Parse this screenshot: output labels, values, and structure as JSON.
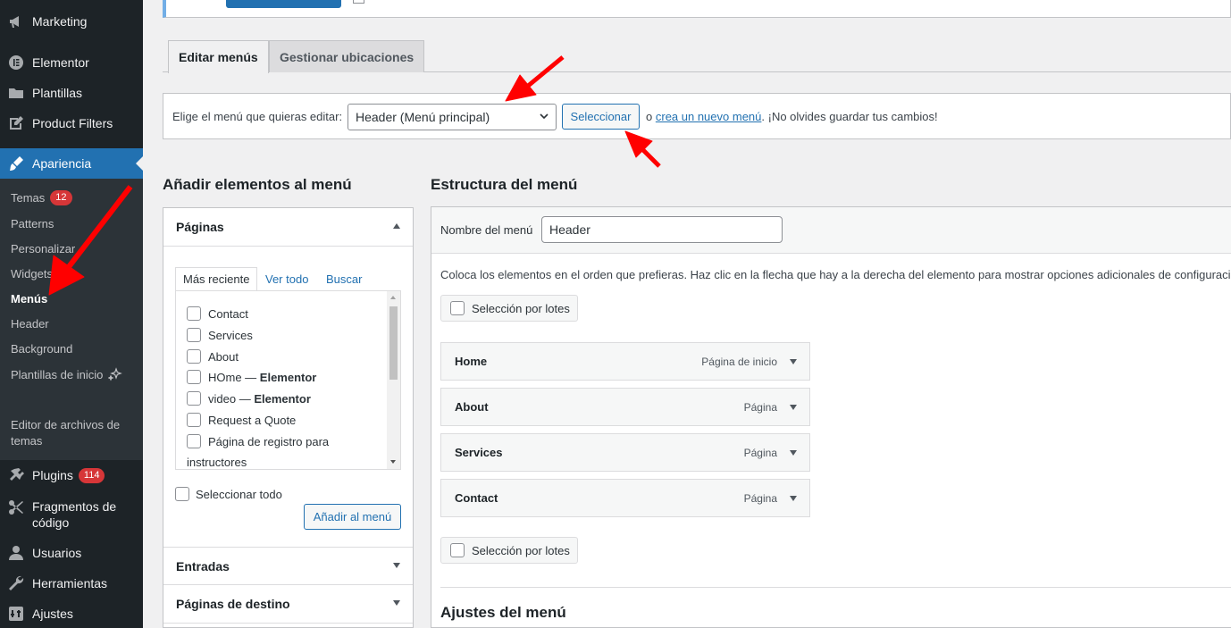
{
  "sidebar": {
    "items": [
      {
        "label": "Marketing",
        "icon": "megaphone-icon"
      },
      {
        "label": "Elementor",
        "icon": "elementor-icon"
      },
      {
        "label": "Plantillas",
        "icon": "folder-icon"
      },
      {
        "label": "Product Filters",
        "icon": "edit-icon"
      },
      {
        "label": "Apariencia",
        "icon": "brush-icon"
      },
      {
        "label": "Plugins",
        "icon": "plugin-icon",
        "badge": "114"
      },
      {
        "label": "Fragmentos de código",
        "icon": "scissors-icon"
      },
      {
        "label": "Usuarios",
        "icon": "user-icon"
      },
      {
        "label": "Herramientas",
        "icon": "wrench-icon"
      },
      {
        "label": "Ajustes",
        "icon": "settings-icon"
      }
    ],
    "submenu": {
      "temas": "Temas",
      "temas_badge": "12",
      "patterns": "Patterns",
      "personalizar": "Personalizar",
      "widgets": "Widgets",
      "menus": "Menús",
      "header": "Header",
      "background": "Background",
      "plantillas_inicio": "Plantillas de inicio",
      "editor_archivos": "Editor de archivos de temas"
    }
  },
  "tabs": {
    "edit": "Editar menús",
    "manage": "Gestionar ubicaciones"
  },
  "select_bar": {
    "label": "Elige el menú que quieras editar:",
    "selected": "Header (Menú principal)",
    "button": "Seleccionar",
    "or": "o",
    "create_link": "crea un nuevo menú",
    "reminder": ". ¡No olvides guardar tus cambios!"
  },
  "add_items": {
    "title": "Añadir elementos al menú",
    "pages_section": "Páginas",
    "tabs": {
      "recent": "Más reciente",
      "all": "Ver todo",
      "search": "Buscar"
    },
    "pages": [
      "Contact",
      "Services",
      "About"
    ],
    "page_home_prefix": "HOme — ",
    "page_home_suffix": "Elementor",
    "page_video_prefix": "video — ",
    "page_video_suffix": "Elementor",
    "page_quote": "Request a Quote",
    "page_registro_1": "Página de registro para",
    "page_registro_2": "instructores",
    "select_all": "Seleccionar todo",
    "add_button": "Añadir al menú",
    "entries_section": "Entradas",
    "landing_section": "Páginas de destino"
  },
  "structure": {
    "title": "Estructura del menú",
    "name_label": "Nombre del menú",
    "name_value": "Header",
    "instructions": "Coloca los elementos en el orden que prefieras. Haz clic en la flecha que hay a la derecha del elemento para mostrar opciones adicionales de configuración.",
    "bulk_select": "Selección por lotes",
    "items": [
      {
        "label": "Home",
        "type": "Página de inicio"
      },
      {
        "label": "About",
        "type": "Página"
      },
      {
        "label": "Services",
        "type": "Página"
      },
      {
        "label": "Contact",
        "type": "Página"
      }
    ],
    "settings_title": "Ajustes del menú"
  },
  "colors": {
    "sidebar_bg": "#1d2327",
    "accent": "#2271b1",
    "annotation_arrow": "#ff0000",
    "badge": "#d63638"
  }
}
